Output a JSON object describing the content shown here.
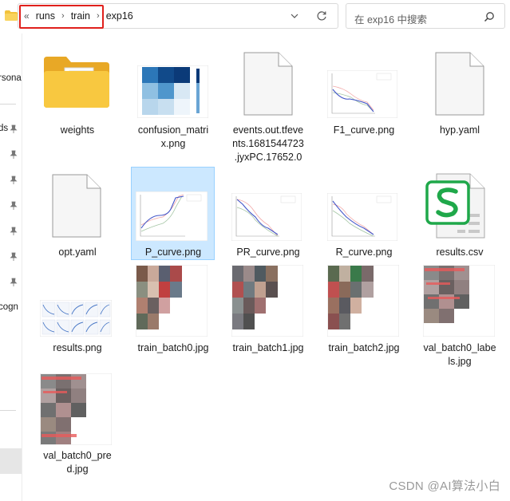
{
  "address_bar": {
    "overflow_glyph": "«",
    "breadcrumbs": [
      "runs",
      "train",
      "exp16"
    ],
    "separator": "›"
  },
  "search": {
    "placeholder": "在 exp16 中搜索"
  },
  "nav_pane": {
    "items": [
      "rsona",
      "ds",
      "cogn"
    ]
  },
  "files": [
    {
      "name": "weights",
      "kind": "folder"
    },
    {
      "name": "confusion_matrix.png",
      "kind": "image-heatmap"
    },
    {
      "name": "events.out.tfevents.1681544723.jyxPC.17652.0",
      "kind": "document"
    },
    {
      "name": "F1_curve.png",
      "kind": "image-curve"
    },
    {
      "name": "hyp.yaml",
      "kind": "document"
    },
    {
      "name": "opt.yaml",
      "kind": "document"
    },
    {
      "name": "P_curve.png",
      "kind": "image-curve",
      "selected": true
    },
    {
      "name": "PR_curve.png",
      "kind": "image-curve"
    },
    {
      "name": "R_curve.png",
      "kind": "image-curve"
    },
    {
      "name": "results.csv",
      "kind": "spreadsheet"
    },
    {
      "name": "results.png",
      "kind": "image-results"
    },
    {
      "name": "train_batch0.jpg",
      "kind": "image-batch"
    },
    {
      "name": "train_batch1.jpg",
      "kind": "image-batch"
    },
    {
      "name": "train_batch2.jpg",
      "kind": "image-batch"
    },
    {
      "name": "val_batch0_labels.jpg",
      "kind": "image-batch"
    },
    {
      "name": "val_batch0_pred.jpg",
      "kind": "image-batch"
    }
  ],
  "labels_wrapped": {
    "weights": [
      "weights"
    ],
    "confusion_matrix": [
      "confusion_matri",
      "x.png"
    ],
    "events": [
      "events.out.tfeve",
      "nts.1681544723",
      ".jyxPC.17652.0"
    ],
    "f1": [
      "F1_curve.png"
    ],
    "hyp": [
      "hyp.yaml"
    ],
    "opt": [
      "opt.yaml"
    ],
    "p_curve": [
      "P_curve.png"
    ],
    "pr_curve": [
      "PR_curve.png"
    ],
    "r_curve": [
      "R_curve.png"
    ],
    "results_csv": [
      "results.csv"
    ],
    "results_png": [
      "results.png"
    ],
    "train0": [
      "train_batch0.jpg"
    ],
    "train1": [
      "train_batch1.jpg"
    ],
    "train2": [
      "train_batch2.jpg"
    ],
    "val_labels": [
      "val_batch0_labe",
      "ls.jpg"
    ],
    "val_pred": [
      "val_batch0_pre",
      "d.jpg"
    ]
  },
  "watermark": "CSDN @AI算法小白",
  "colors": {
    "selection_bg": "#cce8ff",
    "selection_border": "#99d1ff",
    "highlight_box": "#e0201c",
    "folder_yellow": "#f5c542",
    "csv_green": "#1fa84a",
    "heatmap_blue": "#1f5fa8"
  }
}
